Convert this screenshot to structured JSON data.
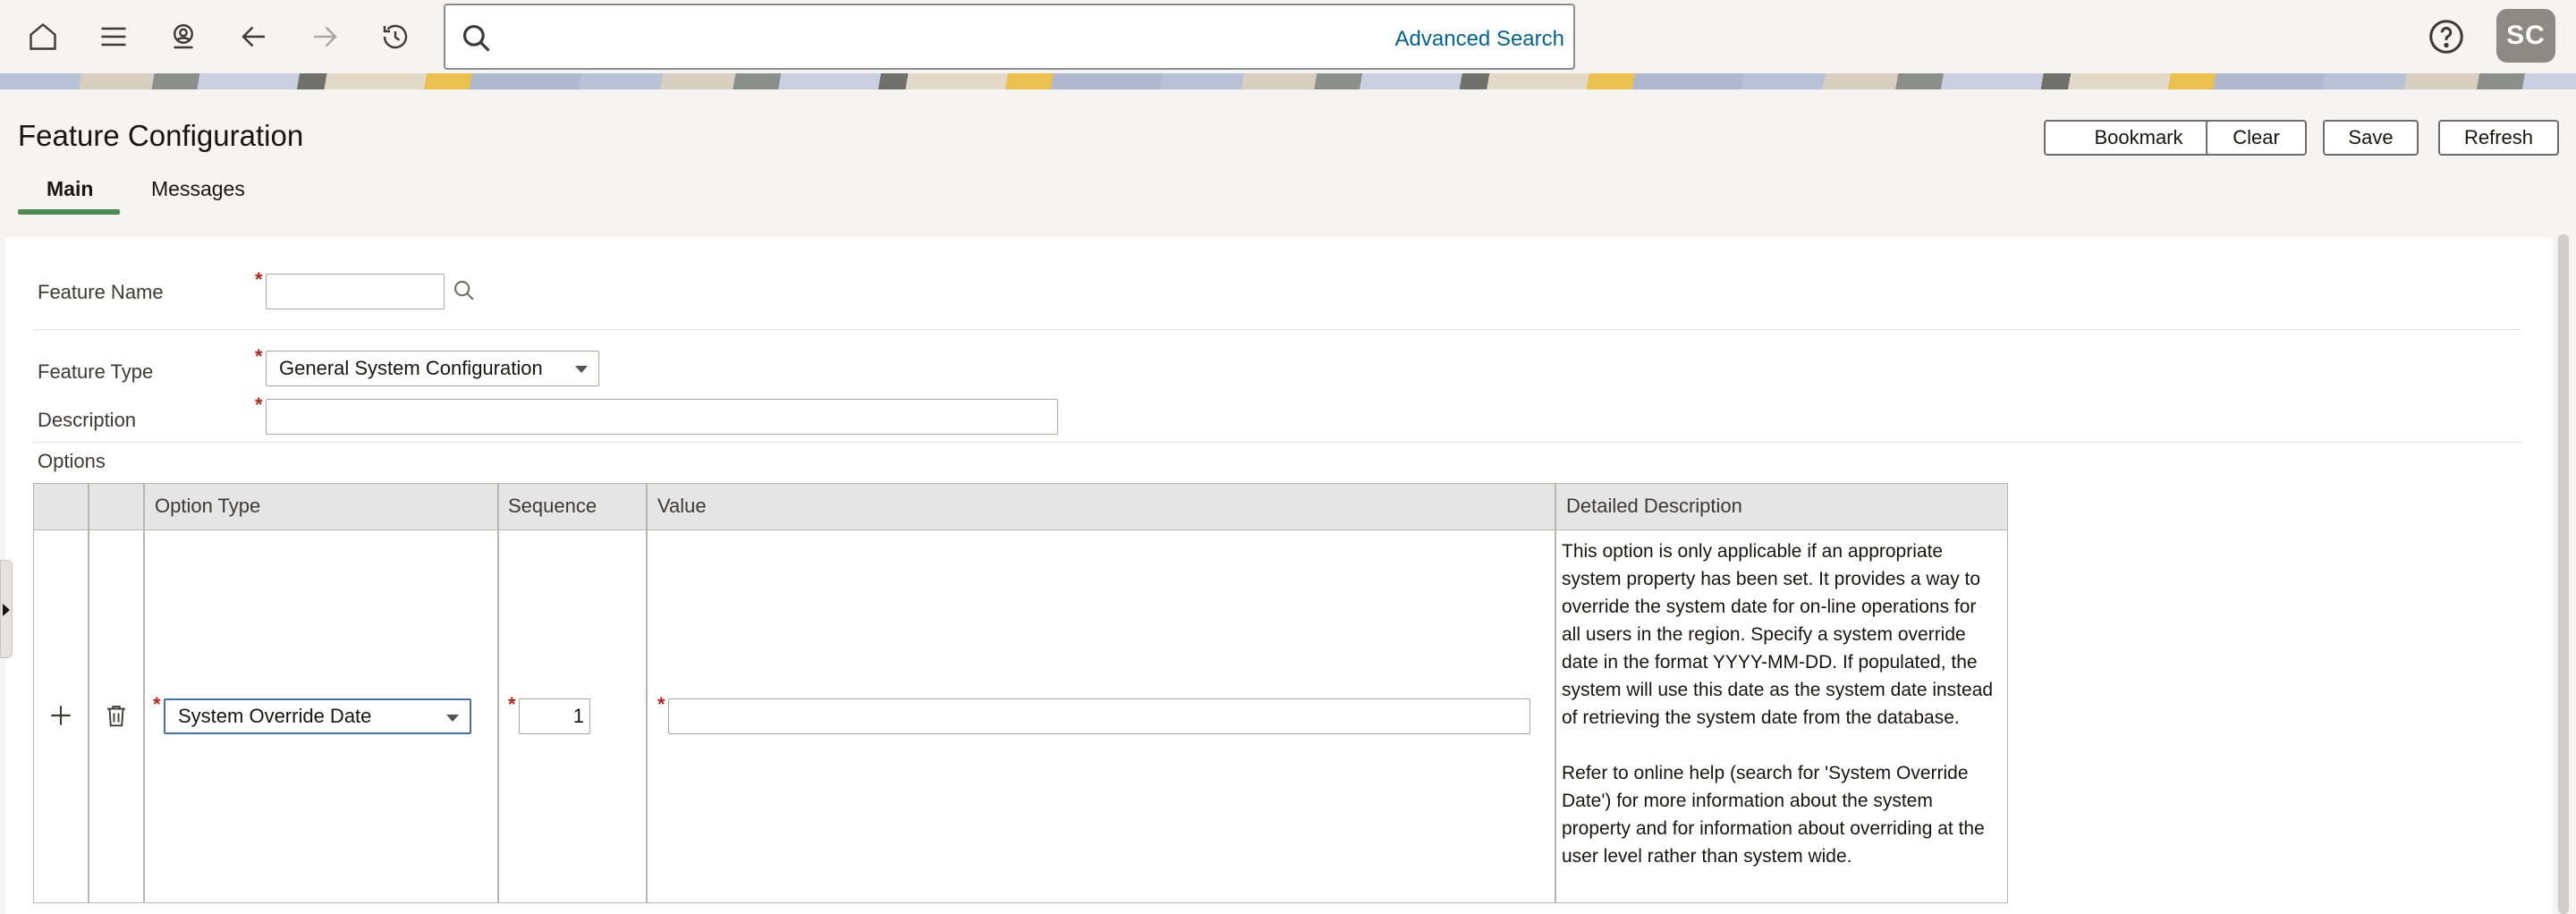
{
  "header": {
    "search_placeholder": "",
    "advanced_search": "Advanced Search",
    "avatar_initials": "SC"
  },
  "page": {
    "title": "Feature Configuration",
    "buttons": {
      "bookmark": "Bookmark",
      "clear": "Clear",
      "save": "Save",
      "refresh": "Refresh"
    },
    "tabs": [
      {
        "label": "Main",
        "active": true
      },
      {
        "label": "Messages",
        "active": false
      }
    ]
  },
  "form": {
    "feature_name": {
      "label": "Feature Name",
      "value": ""
    },
    "feature_type": {
      "label": "Feature Type",
      "value": "General System Configuration"
    },
    "description": {
      "label": "Description",
      "value": ""
    },
    "options_label": "Options"
  },
  "options_grid": {
    "columns": [
      "Option Type",
      "Sequence",
      "Value",
      "Detailed Description"
    ],
    "rows": [
      {
        "option_type": "System Override Date",
        "sequence": "1",
        "value": "",
        "detailed_description": "This option is only applicable if an appropriate system property has been set. It provides a way to override the system date for on-line operations for all users in the region. Specify a system override date in the format YYYY-MM-DD. If populated, the system will use this date as the system date instead of retrieving the system date from the database.\n\nRefer to online help (search for 'System Override Date') for more information about the system property and for information about overriding at the user level rather than system wide."
      }
    ]
  },
  "icons": [
    "home-icon",
    "menu-icon",
    "user-search-icon",
    "back-icon",
    "forward-icon",
    "history-icon",
    "search-icon",
    "help-icon",
    "add-icon",
    "trash-icon"
  ]
}
